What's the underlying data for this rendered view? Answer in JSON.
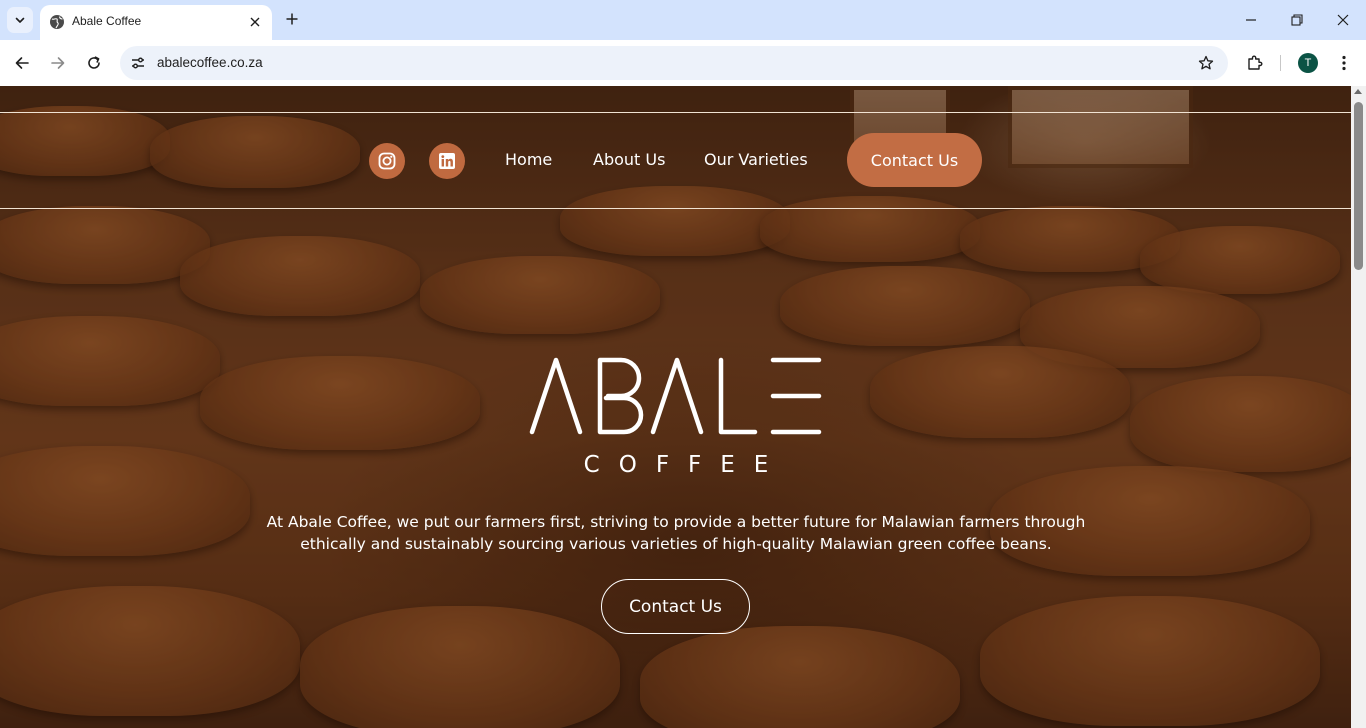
{
  "browser": {
    "tab_title": "Abale Coffee",
    "url": "abalecoffee.co.za",
    "profile_initial": "T"
  },
  "nav": {
    "social": [
      {
        "name": "instagram-icon"
      },
      {
        "name": "linkedin-icon"
      }
    ],
    "links": [
      "Home",
      "About Us",
      "Our Varieties"
    ],
    "cta": "Contact Us"
  },
  "hero": {
    "logo_main": "ABALE",
    "logo_sub": "COFFEE",
    "tagline": "At Abale Coffee, we put our farmers first, striving to provide a better future for Malawian farmers through ethically and sustainably sourcing various varieties of high-quality Malawian green coffee beans.",
    "cta": "Contact Us"
  },
  "colors": {
    "accent": "#c26d44",
    "tabstrip": "#d3e3fd"
  }
}
